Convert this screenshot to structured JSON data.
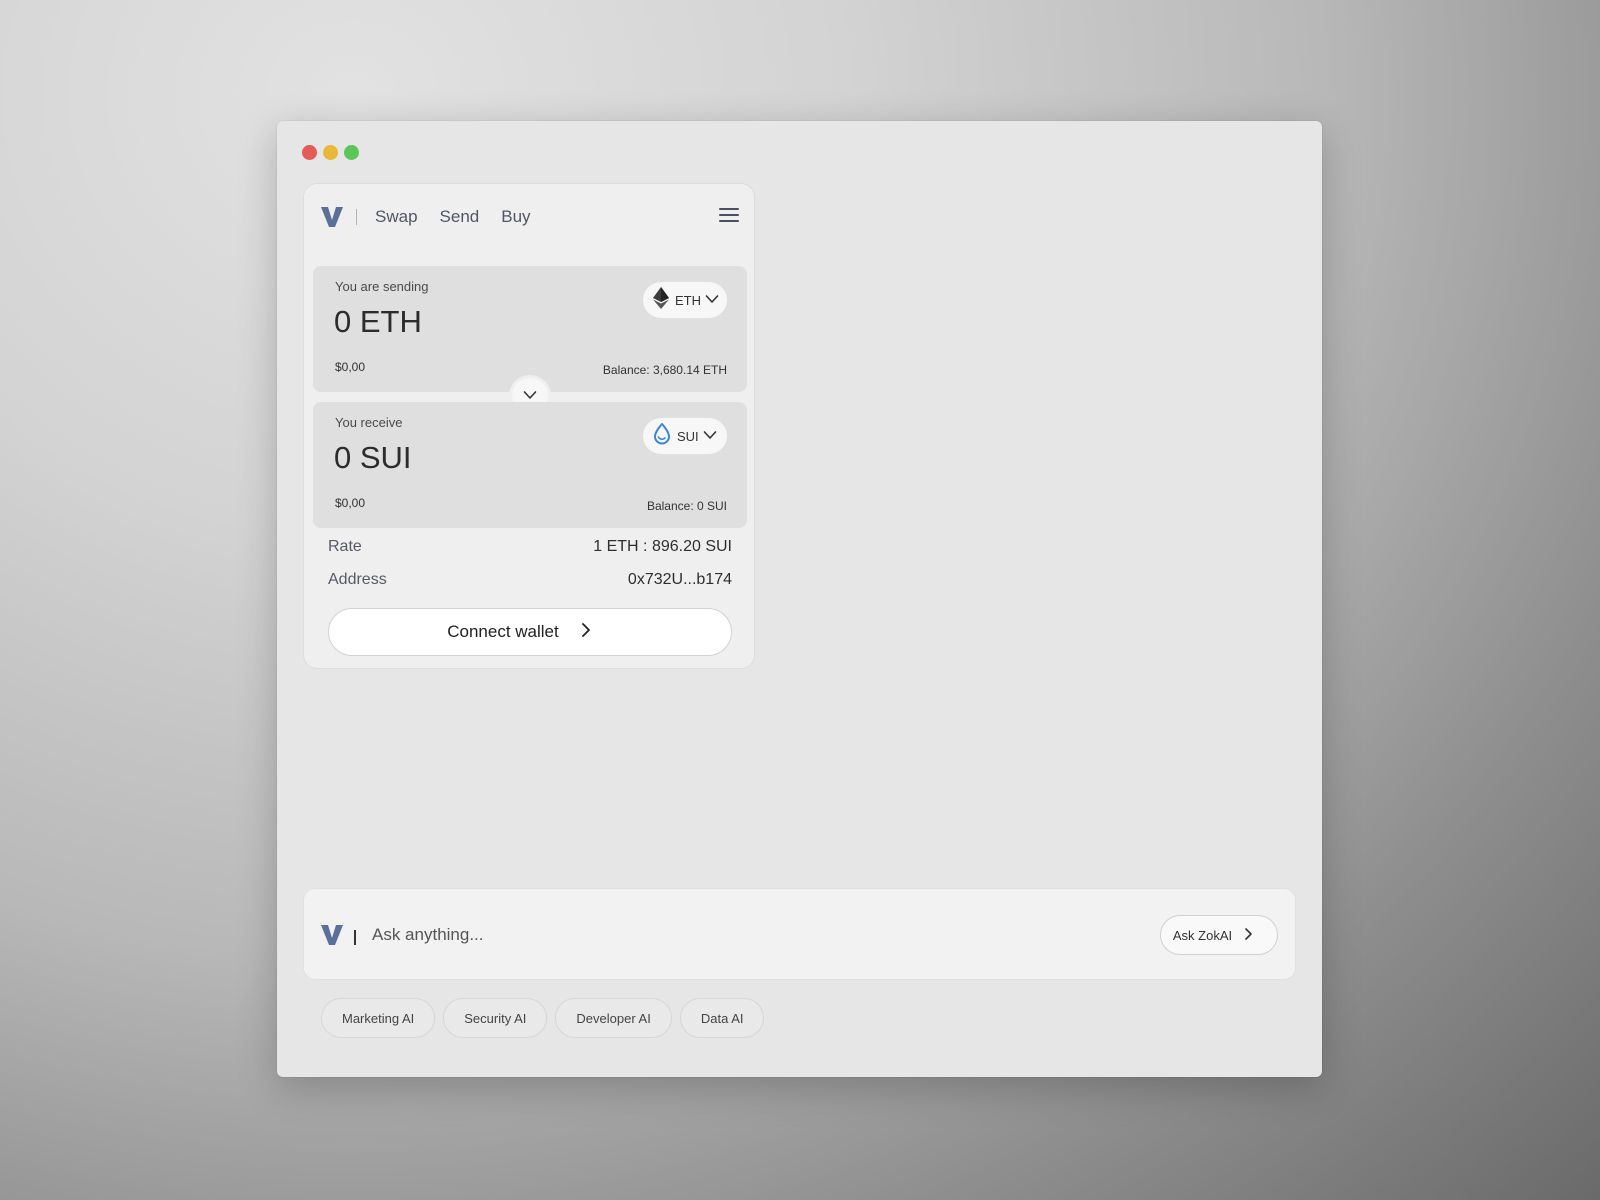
{
  "nav": {
    "items": [
      "Swap",
      "Send",
      "Buy"
    ]
  },
  "send": {
    "label": "You are sending",
    "amount": "0 ETH",
    "fiat": "$0,00",
    "balance": "Balance: 3,680.14 ETH",
    "token": "ETH"
  },
  "receive": {
    "label": "You receive",
    "amount": "0 SUI",
    "fiat": "$0,00",
    "balance": "Balance: 0 SUI",
    "token": "SUI"
  },
  "details": {
    "rate_label": "Rate",
    "rate_value": "1 ETH : 896.20 SUI",
    "address_label": "Address",
    "address_value": "0x732U...b174"
  },
  "connect": {
    "label": "Connect wallet"
  },
  "ask": {
    "placeholder": "Ask anything...",
    "button_label": "Ask ZokAI"
  },
  "chips": [
    "Marketing AI",
    "Security AI",
    "Developer AI",
    "Data AI"
  ],
  "colors": {
    "logo": "#5a6f9a",
    "sui": "#3b84d6",
    "traffic_red": "#e55b58",
    "traffic_yellow": "#e9b73a",
    "traffic_green": "#5ac65a"
  }
}
